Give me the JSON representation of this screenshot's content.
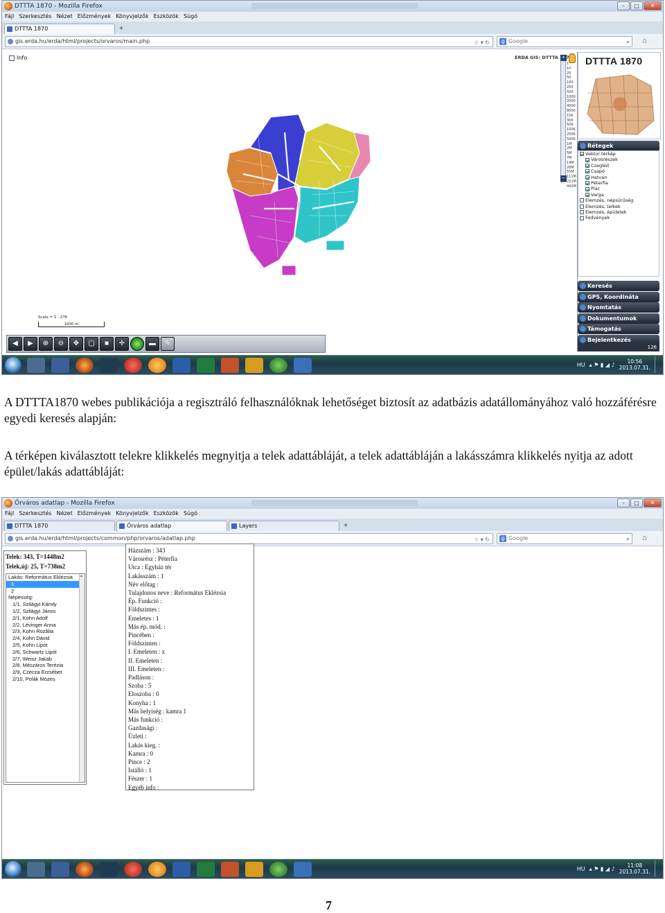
{
  "shot1": {
    "window_title": "DTTTA 1870 - Mozilla Firefox",
    "menu": [
      "Fájl",
      "Szerkesztés",
      "Nézet",
      "Előzmények",
      "Könyvjelzők",
      "Eszközök",
      "Súgó"
    ],
    "tabs": [
      {
        "label": "DTTTA 1870"
      }
    ],
    "url": "gis.erda.hu/erda/html/projects/orvaros/main.php",
    "search_placeholder": "Google",
    "map": {
      "info_label": "Info",
      "erda_label": "ERDA GIS: DTTTA 1870",
      "scale_levels": [
        "1",
        "10",
        "25",
        "50",
        "100",
        "250",
        "500",
        "1000",
        "2000",
        "4000",
        "8000",
        "15K",
        "30K",
        "50K",
        "100K",
        "250K",
        "500K",
        "1M",
        "2M",
        "5M",
        "7M",
        "14M",
        "28M",
        "55M",
        "111M",
        "221M",
        "442M"
      ],
      "scale_text": "Scale = 1 : 27K",
      "scale_bar_label": "1000 m",
      "districts": [
        {
          "name": "Csapó",
          "color": "#3b3fd0"
        },
        {
          "name": "Hatvan",
          "color": "#d6cf3a"
        },
        {
          "name": "Péterfia",
          "color": "#2fc5c8"
        },
        {
          "name": "Varga",
          "color": "#c63cc6"
        },
        {
          "name": "Piac",
          "color": "#d9863a"
        }
      ]
    },
    "panel": {
      "title": "DTTTA 1870",
      "layers_header": "Rétegek",
      "layers": [
        {
          "label": "Vektor térkép",
          "checked": true,
          "level": 0
        },
        {
          "label": "Városrészek",
          "checked": true,
          "level": 1
        },
        {
          "label": "Czegléd",
          "checked": true,
          "level": 1
        },
        {
          "label": "Csapó",
          "checked": true,
          "level": 1
        },
        {
          "label": "Hatvan",
          "checked": true,
          "level": 1
        },
        {
          "label": "Péterfia",
          "checked": true,
          "level": 1
        },
        {
          "label": "Piac",
          "checked": true,
          "level": 1
        },
        {
          "label": "Varga",
          "checked": true,
          "level": 1
        },
        {
          "label": "Elemzés, népsűrűség",
          "checked": false,
          "level": 0
        },
        {
          "label": "Elemzés, telkek",
          "checked": false,
          "level": 0
        },
        {
          "label": "Elemzés, épületek",
          "checked": false,
          "level": 0
        },
        {
          "label": "Fedvények",
          "checked": false,
          "level": 0
        }
      ],
      "buttons": [
        "Keresés",
        "GPS, Koordináta",
        "Nyomtatás",
        "Dokumentumok",
        "Támogatás",
        "Bejelentkezés"
      ],
      "counter": "126"
    },
    "taskbar": {
      "lang": "HU",
      "time": "10:56",
      "date": "2013.07.31."
    }
  },
  "para1": "A DTTTA1870 webes publikációja a regisztráló felhasználóknak lehetőséget biztosít az adatbázis adatállományához való hozzáférésre egyedi keresés alapján:",
  "para2": "A térképen kiválasztott telekre klikkelés megnyitja a telek adattábláját, a telek adattábláján a lakásszámra klikkelés nyitja az adott épület/lakás adattábláját:",
  "shot2": {
    "window_title": "Őrváros adatlap - Mozilla Firefox",
    "menu": [
      "Fájl",
      "Szerkesztés",
      "Nézet",
      "Előzmények",
      "Könyvjelzők",
      "Eszközök",
      "Súgó"
    ],
    "tabs": [
      {
        "label": "DTTTA 1870"
      },
      {
        "label": "Őrváros adatlap"
      },
      {
        "label": "Layers"
      }
    ],
    "url": "gis.erda.hu/erda/html/projects/common/php/orvaros/adatlap.php",
    "search_placeholder": "Google",
    "telek": {
      "line1": "Telek: 343, T=1448m2",
      "line2": "Telek,új: 25, T=738m2",
      "list": [
        {
          "text": "Lakás: Református Eklézsia",
          "cls": ""
        },
        {
          "text": "1",
          "cls": "ind sel"
        },
        {
          "text": "2",
          "cls": "ind"
        },
        {
          "text": "Népesség:",
          "cls": ""
        },
        {
          "text": "1/1, Szilágyi Károly",
          "cls": "ind2"
        },
        {
          "text": "1/2, Szilágyi János",
          "cls": "ind2"
        },
        {
          "text": "2/1, Kohn Adolf",
          "cls": "ind2"
        },
        {
          "text": "2/2, Lévinger Anna",
          "cls": "ind2"
        },
        {
          "text": "2/3, Kohn Rozália",
          "cls": "ind2"
        },
        {
          "text": "2/4, Kohn Dávid",
          "cls": "ind2"
        },
        {
          "text": "2/5, Kohn Lipót",
          "cls": "ind2"
        },
        {
          "text": "2/6, Schwartz Lipót",
          "cls": "ind2"
        },
        {
          "text": "2/7, Weisz Jakab",
          "cls": "ind2"
        },
        {
          "text": "2/8, Mészáros Terézia",
          "cls": "ind2"
        },
        {
          "text": "2/9, Czecza Erzsébet",
          "cls": "ind2"
        },
        {
          "text": "2/10, Polák Mózes",
          "cls": "ind2"
        }
      ]
    },
    "haz": [
      "Házszám : 343",
      "Városrész : Péterfia",
      "Utca : Egyház tér",
      "Lakásszám : 1",
      "Név előtag :",
      "Tulajdonos neve : Református Eklézsia",
      "Ép. Funkció :",
      "Földszintes :",
      "Emeletes : 1",
      "Más ép. mód. :",
      "Pincében :",
      "Földszinten :",
      "I. Emeleten : x",
      "II. Emeleten :",
      "III. Emeleten :",
      "Padláson :",
      "Szoba : 5",
      "Eloszoba : 0",
      "Konyha : 1",
      "Más helyiség : kamra 1",
      "Más funkció :",
      "Gazdasági :",
      "Üzleti :",
      "Lakás kieg. :",
      "Kamra : 0",
      "Pince : 2",
      "Istálló : 1",
      "Fészer : 1",
      "Egyéb info :"
    ],
    "taskbar": {
      "lang": "HU",
      "time": "11:08",
      "date": "2013.07.31."
    }
  },
  "page_number": "7"
}
